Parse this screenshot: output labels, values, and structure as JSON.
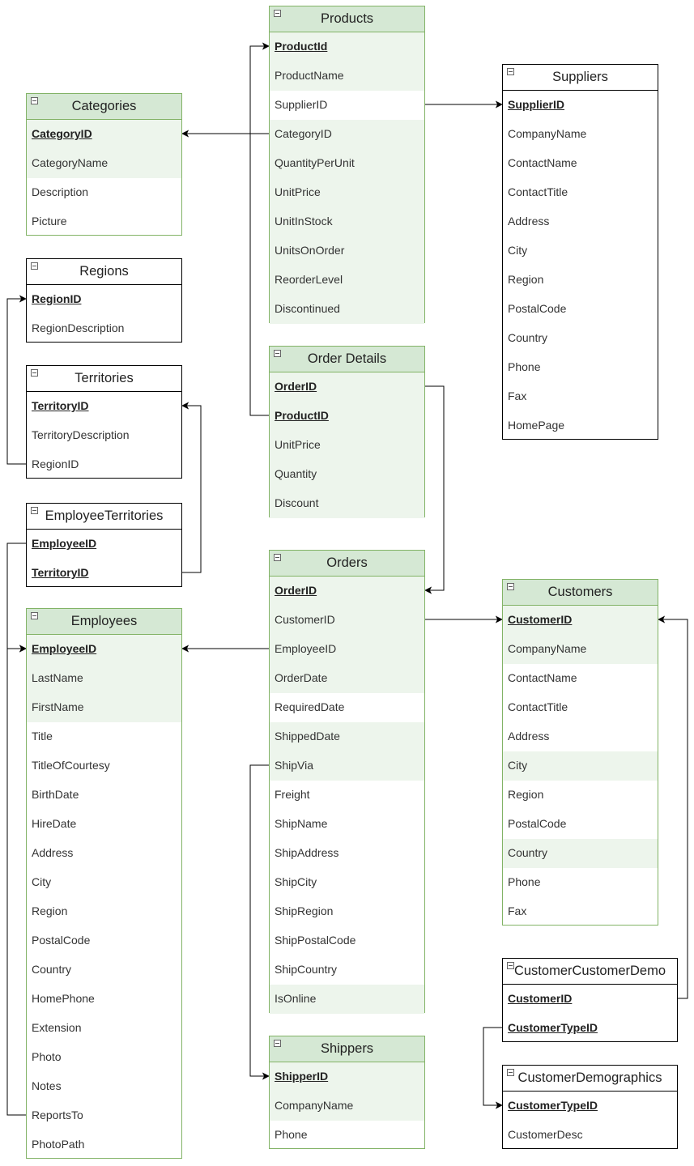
{
  "tables": [
    {
      "id": "products",
      "title": "Products",
      "style": "green",
      "rows": [
        {
          "label": "ProductId",
          "pk": true,
          "hl": true
        },
        {
          "label": "ProductName",
          "hl": true
        },
        {
          "label": "SupplierID"
        },
        {
          "label": "CategoryID",
          "hl": true
        },
        {
          "label": "QuantityPerUnit",
          "hl": true
        },
        {
          "label": "UnitPrice",
          "hl": true
        },
        {
          "label": "UnitInStock",
          "hl": true
        },
        {
          "label": "UnitsOnOrder",
          "hl": true
        },
        {
          "label": "ReorderLevel",
          "hl": true
        },
        {
          "label": "Discontinued",
          "hl": true
        }
      ]
    },
    {
      "id": "suppliers",
      "title": "Suppliers",
      "style": "plain",
      "rows": [
        {
          "label": "SupplierID",
          "pk": true
        },
        {
          "label": "CompanyName"
        },
        {
          "label": "ContactName"
        },
        {
          "label": "ContactTitle"
        },
        {
          "label": "Address"
        },
        {
          "label": "City"
        },
        {
          "label": "Region"
        },
        {
          "label": "PostalCode"
        },
        {
          "label": "Country"
        },
        {
          "label": "Phone"
        },
        {
          "label": "Fax"
        },
        {
          "label": "HomePage"
        }
      ]
    },
    {
      "id": "categories",
      "title": "Categories",
      "style": "green",
      "rows": [
        {
          "label": "CategoryID",
          "pk": true,
          "hl": true
        },
        {
          "label": "CategoryName",
          "hl": true
        },
        {
          "label": "Description"
        },
        {
          "label": "Picture"
        }
      ]
    },
    {
      "id": "regions",
      "title": "Regions",
      "style": "plain",
      "rows": [
        {
          "label": "RegionID",
          "pk": true
        },
        {
          "label": "RegionDescription"
        }
      ]
    },
    {
      "id": "territories",
      "title": "Territories",
      "style": "plain",
      "rows": [
        {
          "label": "TerritoryID",
          "pk": true
        },
        {
          "label": "TerritoryDescription"
        },
        {
          "label": "RegionID"
        }
      ]
    },
    {
      "id": "employeeterritories",
      "title": "EmployeeTerritories",
      "style": "plain",
      "rows": [
        {
          "label": "EmployeeID",
          "pk": true
        },
        {
          "label": "TerritoryID",
          "pk": true
        }
      ]
    },
    {
      "id": "orderdetails",
      "title": "Order Details",
      "style": "green",
      "rows": [
        {
          "label": "OrderID",
          "pk": true,
          "hl": true
        },
        {
          "label": "ProductID",
          "pk": true,
          "hl": true
        },
        {
          "label": "UnitPrice",
          "hl": true
        },
        {
          "label": "Quantity",
          "hl": true
        },
        {
          "label": "Discount",
          "hl": true
        }
      ]
    },
    {
      "id": "orders",
      "title": "Orders",
      "style": "green",
      "rows": [
        {
          "label": "OrderID",
          "pk": true,
          "hl": true
        },
        {
          "label": "CustomerID",
          "hl": true
        },
        {
          "label": "EmployeeID",
          "hl": true
        },
        {
          "label": "OrderDate",
          "hl": true
        },
        {
          "label": "RequiredDate"
        },
        {
          "label": "ShippedDate",
          "hl": true
        },
        {
          "label": "ShipVia",
          "hl": true
        },
        {
          "label": "Freight"
        },
        {
          "label": "ShipName"
        },
        {
          "label": "ShipAddress"
        },
        {
          "label": "ShipCity"
        },
        {
          "label": "ShipRegion"
        },
        {
          "label": "ShipPostalCode"
        },
        {
          "label": "ShipCountry"
        },
        {
          "label": "IsOnline",
          "hl": true
        }
      ]
    },
    {
      "id": "customers",
      "title": "Customers",
      "style": "green",
      "rows": [
        {
          "label": "CustomerID",
          "pk": true,
          "hl": true
        },
        {
          "label": "CompanyName",
          "hl": true
        },
        {
          "label": "ContactName"
        },
        {
          "label": "ContactTitle"
        },
        {
          "label": "Address"
        },
        {
          "label": "City",
          "hl": true
        },
        {
          "label": "Region"
        },
        {
          "label": "PostalCode"
        },
        {
          "label": "Country",
          "hl": true
        },
        {
          "label": "Phone"
        },
        {
          "label": "Fax"
        }
      ]
    },
    {
      "id": "employees",
      "title": "Employees",
      "style": "green",
      "rows": [
        {
          "label": "EmployeeID",
          "pk": true,
          "hl": true
        },
        {
          "label": "LastName",
          "hl": true
        },
        {
          "label": "FirstName",
          "hl": true
        },
        {
          "label": "Title"
        },
        {
          "label": "TitleOfCourtesy"
        },
        {
          "label": "BirthDate"
        },
        {
          "label": "HireDate"
        },
        {
          "label": "Address"
        },
        {
          "label": "City"
        },
        {
          "label": "Region"
        },
        {
          "label": "PostalCode"
        },
        {
          "label": "Country"
        },
        {
          "label": "HomePhone"
        },
        {
          "label": "Extension"
        },
        {
          "label": "Photo"
        },
        {
          "label": "Notes"
        },
        {
          "label": "ReportsTo"
        },
        {
          "label": "PhotoPath"
        }
      ]
    },
    {
      "id": "customercustomerdemo",
      "title": "CustomerCustomerDemo",
      "style": "plain",
      "rows": [
        {
          "label": "CustomerID",
          "pk": true
        },
        {
          "label": "CustomerTypeID",
          "pk": true
        }
      ]
    },
    {
      "id": "customerdemographics",
      "title": "CustomerDemographics",
      "style": "plain",
      "rows": [
        {
          "label": "CustomerTypeID",
          "pk": true
        },
        {
          "label": "CustomerDesc"
        }
      ]
    },
    {
      "id": "shippers",
      "title": "Shippers",
      "style": "green",
      "rows": [
        {
          "label": "ShipperID",
          "pk": true,
          "hl": true
        },
        {
          "label": "CompanyName",
          "hl": true
        },
        {
          "label": "Phone"
        }
      ]
    }
  ],
  "relationships": [
    {
      "from": "products.SupplierID",
      "to": "suppliers.SupplierID"
    },
    {
      "from": "products.CategoryID",
      "to": "categories.CategoryID"
    },
    {
      "from": "orderdetails.ProductID",
      "to": "products.ProductId"
    },
    {
      "from": "orderdetails.OrderID",
      "to": "orders.OrderID"
    },
    {
      "from": "orders.CustomerID",
      "to": "customers.CustomerID"
    },
    {
      "from": "orders.EmployeeID",
      "to": "employees.EmployeeID"
    },
    {
      "from": "orders.ShipVia",
      "to": "shippers.ShipperID"
    },
    {
      "from": "territories.RegionID",
      "to": "regions.RegionID"
    },
    {
      "from": "employeeterritories.TerritoryID",
      "to": "territories.TerritoryID"
    },
    {
      "from": "employeeterritories.EmployeeID",
      "to": "employees.EmployeeID"
    },
    {
      "from": "employees.ReportsTo",
      "to": "employees.EmployeeID"
    },
    {
      "from": "customercustomerdemo.CustomerID",
      "to": "customers.CustomerID"
    },
    {
      "from": "customercustomerdemo.CustomerTypeID",
      "to": "customerdemographics.CustomerTypeID"
    }
  ]
}
